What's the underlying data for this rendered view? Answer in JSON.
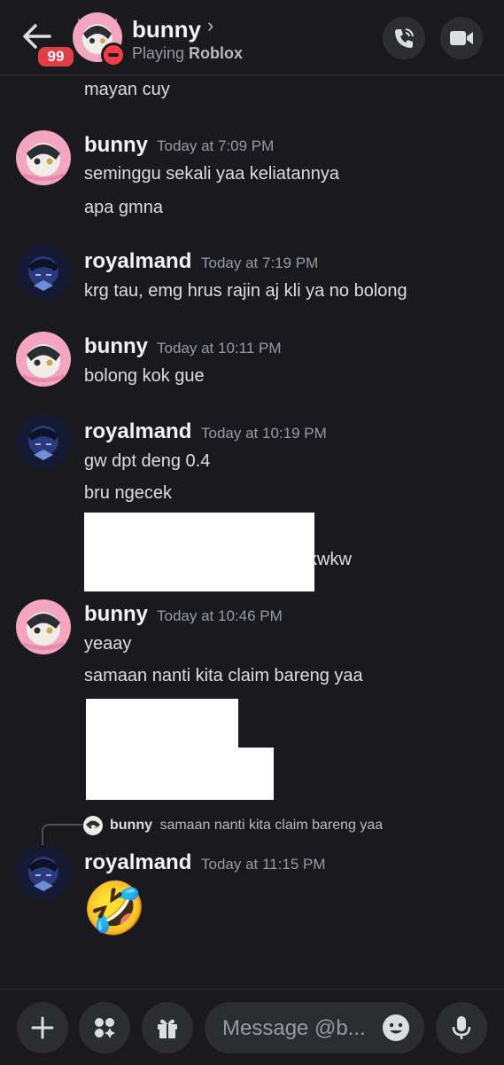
{
  "header": {
    "name": "bunny",
    "status_prefix": "Playing ",
    "status_game": "Roblox",
    "unread_badge": "99"
  },
  "messages": {
    "top_continuation": "mayan cuy",
    "g1": {
      "author": "bunny",
      "time": "Today at 7:09 PM",
      "lines": [
        "seminggu sekali yaa keliatannya",
        "apa gmna"
      ]
    },
    "g2": {
      "author": "royalmand",
      "time": "Today at 7:19 PM",
      "lines": [
        "krg tau, emg hrus rajin aj kli ya no bolong"
      ]
    },
    "g3": {
      "author": "bunny",
      "time": "Today at 10:11 PM",
      "lines": [
        "bolong kok gue"
      ]
    },
    "g4": {
      "author": "royalmand",
      "time": "Today at 10:19 PM",
      "lines": [
        "gw dpt deng 0.4",
        "bru ngecek"
      ],
      "tail_text": "kwkw"
    },
    "g5": {
      "author": "bunny",
      "time": "Today at 10:46 PM",
      "lines": [
        "yeaay",
        "samaan nanti kita claim bareng yaa"
      ]
    },
    "reply": {
      "author": "bunny",
      "text": "samaan nanti kita claim bareng yaa"
    },
    "g6": {
      "author": "royalmand",
      "time": "Today at 11:15 PM",
      "emoji": "🤣"
    }
  },
  "composer": {
    "placeholder": "Message @b..."
  },
  "colors": {
    "background": "#1a1a1e",
    "accent_red": "#e23f44",
    "pink_avatar": "#f4a6c0",
    "blue_avatar": "#2a3a7a"
  }
}
